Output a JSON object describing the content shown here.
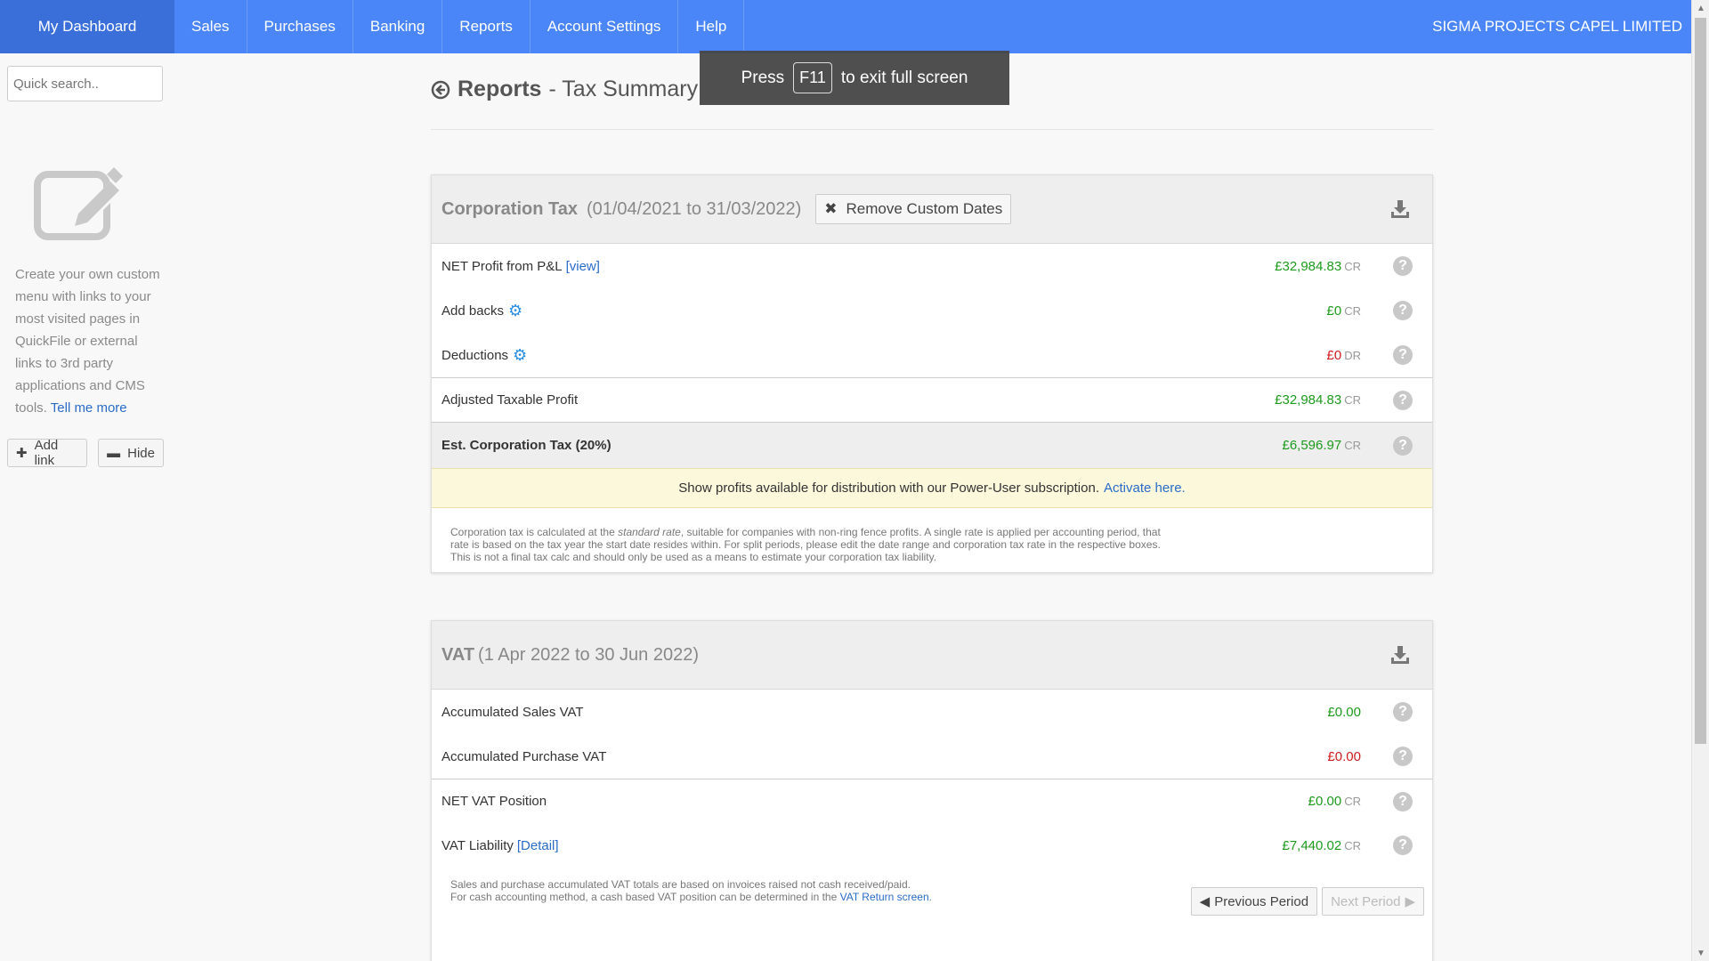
{
  "nav": {
    "home": "My Dashboard",
    "items": [
      "Sales",
      "Purchases",
      "Banking",
      "Reports",
      "Account Settings",
      "Help"
    ],
    "company": "SIGMA PROJECTS CAPEL LIMITED"
  },
  "sidebar": {
    "search_placeholder": "Quick search..",
    "custom_text": "Create your own custom menu with links to your most visited pages in QuickFile or external links to 3rd party applications and CMS tools.",
    "tell_more": "Tell me more",
    "add_link": "Add link",
    "hide": "Hide"
  },
  "header": {
    "title": "Reports",
    "subtitle": "- Tax Summary"
  },
  "toast": {
    "press": "Press",
    "key": "F11",
    "rest": "to exit full screen"
  },
  "corp": {
    "title": "Corporation Tax",
    "dates": "(01/04/2021 to 31/03/2022)",
    "remove_label": "Remove Custom Dates",
    "rows": {
      "net_label": "NET Profit from P&L",
      "net_link": "[view]",
      "net_value": "£32,984.83",
      "net_suffix": "CR",
      "addbacks_label": "Add backs",
      "addbacks_value": "£0",
      "addbacks_suffix": "CR",
      "deductions_label": "Deductions",
      "deductions_value": "£0",
      "deductions_suffix": "DR",
      "adjusted_label": "Adjusted Taxable Profit",
      "adjusted_value": "£32,984.83",
      "adjusted_suffix": "CR",
      "est_label": "Est. Corporation Tax (20%)",
      "est_value": "£6,596.97",
      "est_suffix": "CR"
    },
    "promo_text": "Show profits available for distribution with our Power-User subscription.",
    "promo_link": "Activate here.",
    "note_pre": "Corporation tax is calculated at the ",
    "note_em": "standard rate",
    "note_post": ", suitable for companies with non-ring fence profits. A single rate is applied per accounting period, that rate is based on the tax year the start date resides within. For split periods, please edit the date range and corporation tax rate in the respective boxes. This is not a final tax calc and should only be used as a means to estimate your corporation tax liability."
  },
  "vat": {
    "title": "VAT",
    "dates": "(1 Apr 2022 to 30 Jun 2022)",
    "rows": {
      "sales_label": "Accumulated Sales VAT",
      "sales_value": "£0.00",
      "purchase_label": "Accumulated Purchase VAT",
      "purchase_value": "£0.00",
      "net_label": "NET VAT Position",
      "net_value": "£0.00",
      "net_suffix": "CR",
      "liability_label": "VAT Liability",
      "liability_link": "[Detail]",
      "liability_value": "£7,440.02",
      "liability_suffix": "CR"
    },
    "note_line1": "Sales and purchase accumulated VAT totals are based on invoices raised not cash received/paid.",
    "note_line2": "For cash accounting method, a cash based VAT position can be determined in the ",
    "note_link": "VAT Return screen",
    "note_end": ".",
    "prev_label": "Previous Period",
    "next_label": "Next Period"
  },
  "colors": {
    "nav": "#4a86f7",
    "nav_home": "#3a6fd9",
    "credit": "#1c9a1c",
    "debit": "#d01c1c",
    "link": "#2a6cc7"
  }
}
